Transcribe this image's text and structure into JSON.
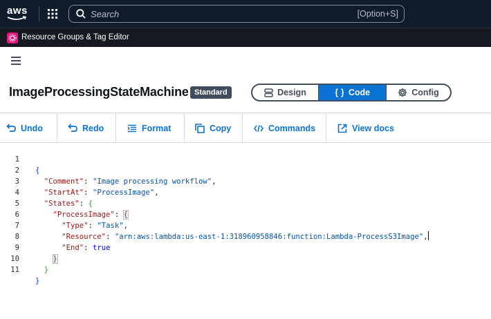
{
  "topnav": {
    "logo_text": "aws",
    "search_placeholder": "Search",
    "search_shortcut": "[Option+S]"
  },
  "servicebar": {
    "service_name": "Resource Groups & Tag Editor",
    "service_color": "#e7157b"
  },
  "header": {
    "title": "ImageProcessingStateMachine",
    "badge": "Standard",
    "modes": {
      "design": "Design",
      "code": "Code",
      "config": "Config",
      "selected": "Code"
    }
  },
  "toolbar": {
    "undo": "Undo",
    "redo": "Redo",
    "format": "Format",
    "copy": "Copy",
    "commands": "Commands",
    "view_docs": "View docs"
  },
  "editor": {
    "line_numbers": [
      "1",
      "2",
      "3",
      "4",
      "5",
      "6",
      "7",
      "8",
      "9",
      "10",
      "11"
    ],
    "code": {
      "l1_open": "{",
      "comment_key": "\"Comment\"",
      "comment_val": "\"Image processing workflow\"",
      "startat_key": "\"StartAt\"",
      "startat_val": "\"ProcessImage\"",
      "states_key": "\"States\"",
      "states_open": "{",
      "process_key": "\"ProcessImage\"",
      "process_open": "{",
      "type_key": "\"Type\"",
      "type_val": "\"Task\"",
      "resource_key": "\"Resource\"",
      "resource_val": "\"arn:aws:lambda:us-east-1:318960958846:function:Lambda-ProcessS3Image\"",
      "end_key": "\"End\"",
      "end_val": "true",
      "process_close": "}",
      "states_close": "}",
      "l11_close": "}"
    }
  },
  "colors": {
    "nav_bg": "#0f1b2a",
    "accent": "#0972d3",
    "badge_bg": "#414d5c"
  }
}
